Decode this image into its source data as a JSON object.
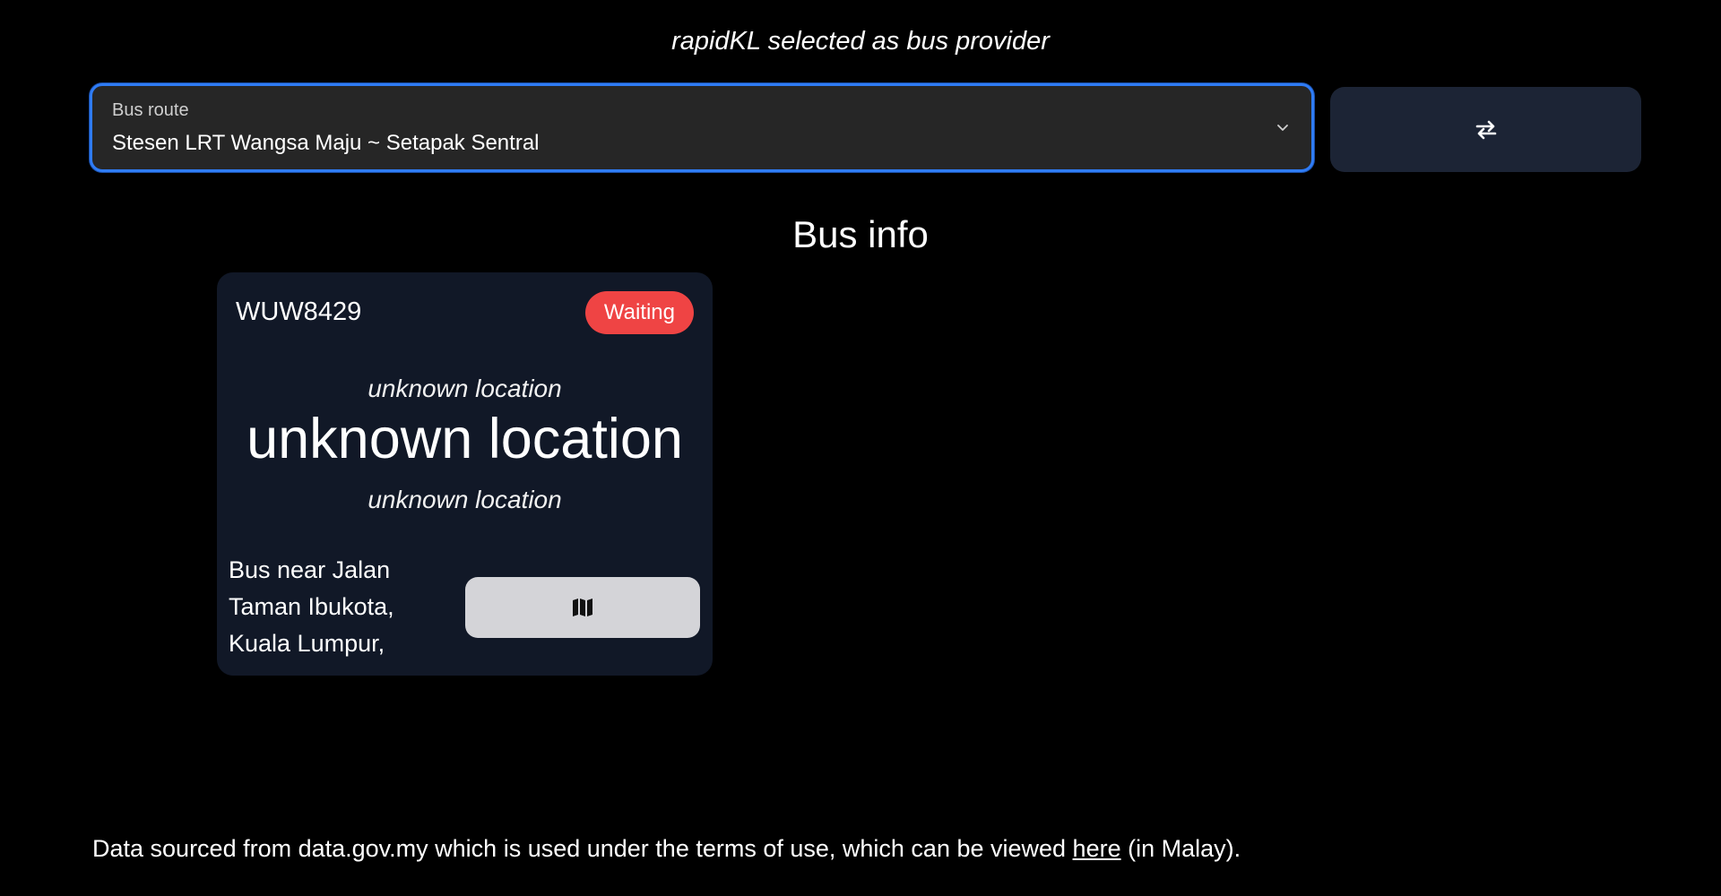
{
  "header": {
    "provider_text": "rapidKL selected as bus provider"
  },
  "route_selector": {
    "label": "Bus route",
    "value": "Stesen LRT Wangsa Maju ~ Setapak Sentral",
    "icon": "chevron-down-icon"
  },
  "swap_button": {
    "icon": "swap-arrows-icon"
  },
  "bus_info": {
    "title": "Bus info",
    "buses": [
      {
        "plate": "WUW8429",
        "status": "Waiting",
        "status_color": "#ef4444",
        "previous_stop": "unknown location",
        "current_stop": "unknown location",
        "next_stop": "unknown location",
        "nearby_text": "Bus near Jalan Taman Ibukota, Kuala Lumpur,",
        "map_button_icon": "map-icon"
      }
    ]
  },
  "footer": {
    "text_before_link": "Data sourced from data.gov.my which is used under the terms of use, which can be viewed ",
    "link_text": "here",
    "text_after_link": " (in Malay)."
  },
  "colors": {
    "background": "#000000",
    "accent": "#2f7cf6",
    "card": "#111827",
    "swap_button": "#1c2435",
    "map_button": "#d4d4d8"
  }
}
